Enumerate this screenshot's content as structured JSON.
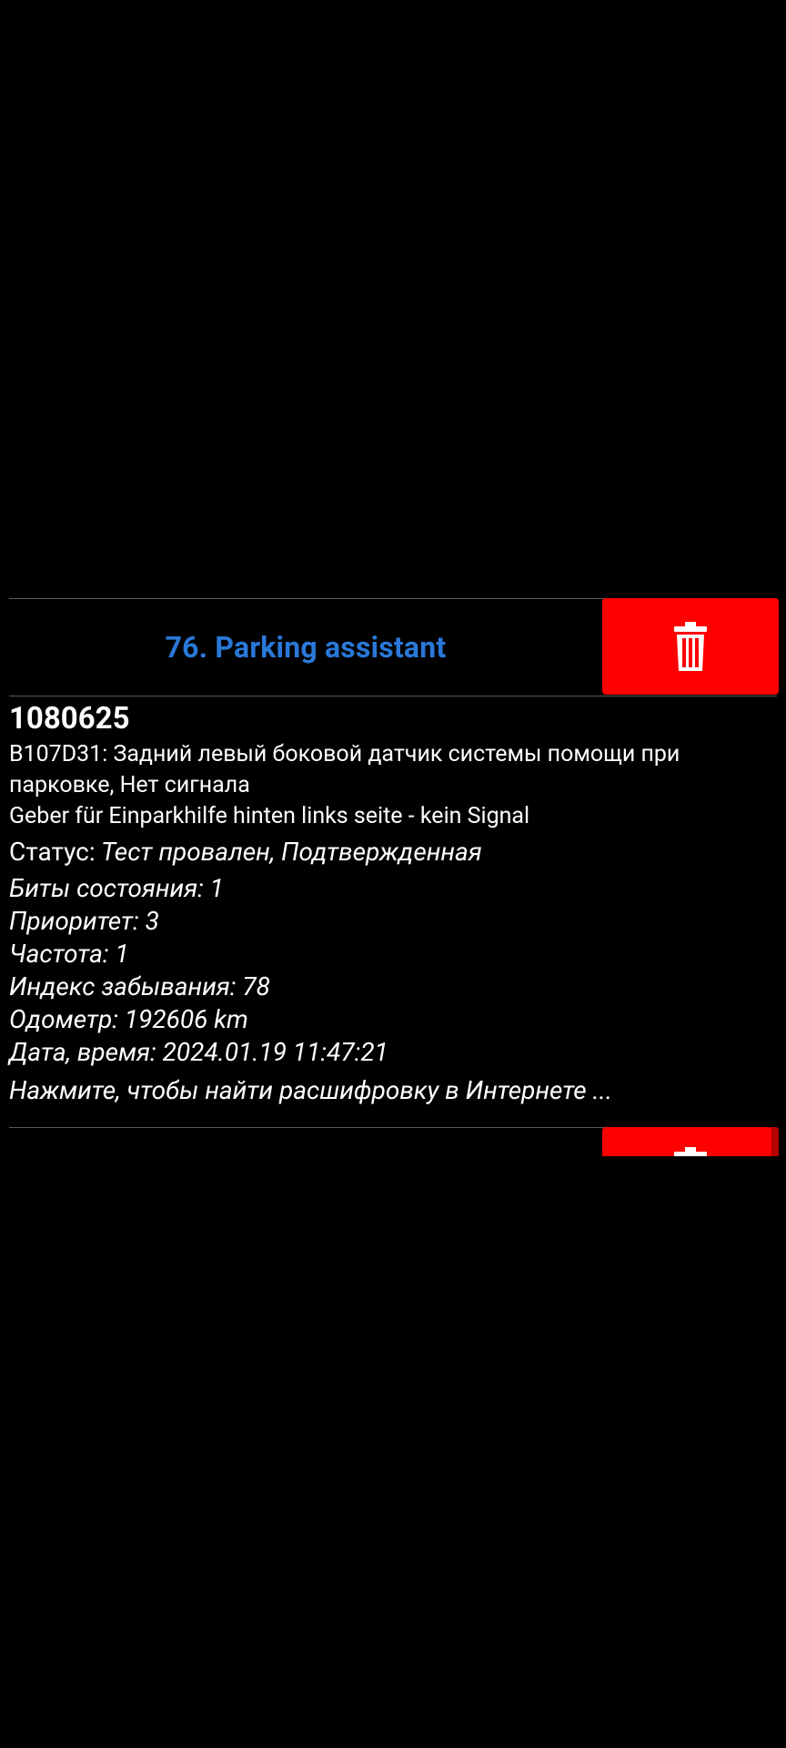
{
  "card": {
    "title": "76. Parking assistant",
    "delete_icon": "trash-icon",
    "code": "1080625",
    "description_ru": "B107D31: Задний левый боковой датчик системы помощи при парковке, Нет сигнала",
    "description_de": "Geber für Einparkhilfe hinten links seite - kein Signal",
    "status_label": "Статус:",
    "status_value": "Тест провален, Подтвержденная",
    "status_bits": "Биты состояния: 1",
    "priority": "Приоритет: 3",
    "frequency": "Частота: 1",
    "forget_index": "Индекс забывания: 78",
    "odometer": "Одометр: 192606 km",
    "datetime": "Дата, время: 2024.01.19 11:47:21",
    "search_link": "Нажмите, чтобы найти расшифровку в Интернете ..."
  },
  "colors": {
    "background": "#000000",
    "title": "#2a78d8",
    "delete_button": "#ff0000",
    "text": "#ffffff",
    "divider": "#5a5a5a"
  }
}
